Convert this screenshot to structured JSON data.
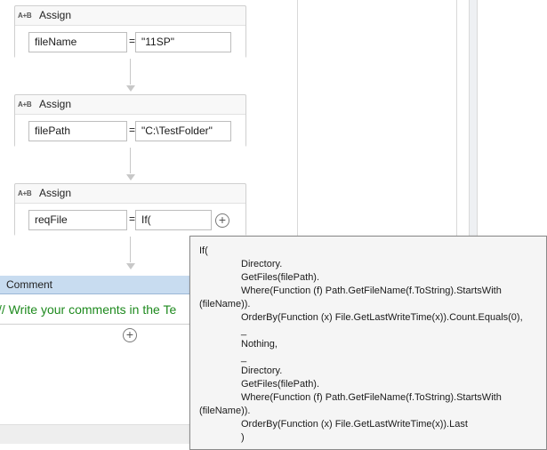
{
  "activities": [
    {
      "title": "Assign",
      "icon": "A+B",
      "to": "fileName",
      "value": "\"11SP\""
    },
    {
      "title": "Assign",
      "icon": "A+B",
      "to": "filePath",
      "value": "\"C:\\TestFolder\""
    },
    {
      "title": "Assign",
      "icon": "A+B",
      "to": "reqFile",
      "value": "If("
    }
  ],
  "equals": "=",
  "comment": {
    "title": "Comment",
    "text": "// Write your comments in the Te"
  },
  "plus": "+",
  "tooltip": {
    "lines": [
      "If(",
      "Directory.",
      "GetFiles(filePath).",
      "Where(Function (f) Path.GetFileName(f.ToString).StartsWith",
      "(fileName)).",
      "OrderBy(Function (x) File.GetLastWriteTime(x)).Count.Equals(0),",
      "_",
      "Nothing,",
      "_",
      "Directory.",
      "GetFiles(filePath).",
      "Where(Function (f) Path.GetFileName(f.ToString).StartsWith",
      "(fileName)).",
      "OrderBy(Function (x) File.GetLastWriteTime(x)).Last",
      ")"
    ]
  }
}
